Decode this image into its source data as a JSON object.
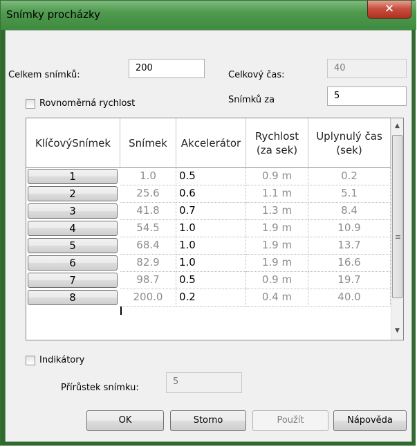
{
  "window": {
    "title": "Snímky procházky",
    "close_icon": "close-icon"
  },
  "total_frames": {
    "label": "Celkem snímků:",
    "value": "200"
  },
  "total_time": {
    "label": "Celkový čas:",
    "value": "40"
  },
  "uniform_speed": {
    "label": "Rovnoměrná rychlost",
    "checked": false
  },
  "frames_per": {
    "label": "Snímků za",
    "value": "5"
  },
  "table": {
    "headers": {
      "key": "KlíčovýSnímek",
      "frame": "Snímek",
      "acc": "Akcelerátor",
      "speed": "Rychlost\n(za sek)",
      "elapsed": "Uplynulý čas\n(sek)"
    },
    "rows": [
      {
        "key": "1",
        "frame": "1.0",
        "acc": "0.5",
        "speed": "0.9 m",
        "elapsed": "0.2"
      },
      {
        "key": "2",
        "frame": "25.6",
        "acc": "0.6",
        "speed": "1.1 m",
        "elapsed": "5.1"
      },
      {
        "key": "3",
        "frame": "41.8",
        "acc": "0.7",
        "speed": "1.3 m",
        "elapsed": "8.4"
      },
      {
        "key": "4",
        "frame": "54.5",
        "acc": "1.0",
        "speed": "1.9 m",
        "elapsed": "10.9"
      },
      {
        "key": "5",
        "frame": "68.4",
        "acc": "1.0",
        "speed": "1.9 m",
        "elapsed": "13.7"
      },
      {
        "key": "6",
        "frame": "82.9",
        "acc": "1.0",
        "speed": "1.9 m",
        "elapsed": "16.6"
      },
      {
        "key": "7",
        "frame": "98.7",
        "acc": "0.5",
        "speed": "0.9 m",
        "elapsed": "19.7"
      },
      {
        "key": "8",
        "frame": "200.0",
        "acc": "0.2",
        "speed": "0.4 m",
        "elapsed": "40.0"
      }
    ]
  },
  "indicators": {
    "label": "Indikátory",
    "checked": false
  },
  "frame_increment": {
    "label": "Přírůstek snímku:",
    "value": "5"
  },
  "buttons": {
    "ok": "OK",
    "cancel": "Storno",
    "apply": "Použít",
    "help": "Nápověda"
  },
  "colors": {
    "title_bar": "#4f9a4f",
    "close": "#c75040"
  }
}
